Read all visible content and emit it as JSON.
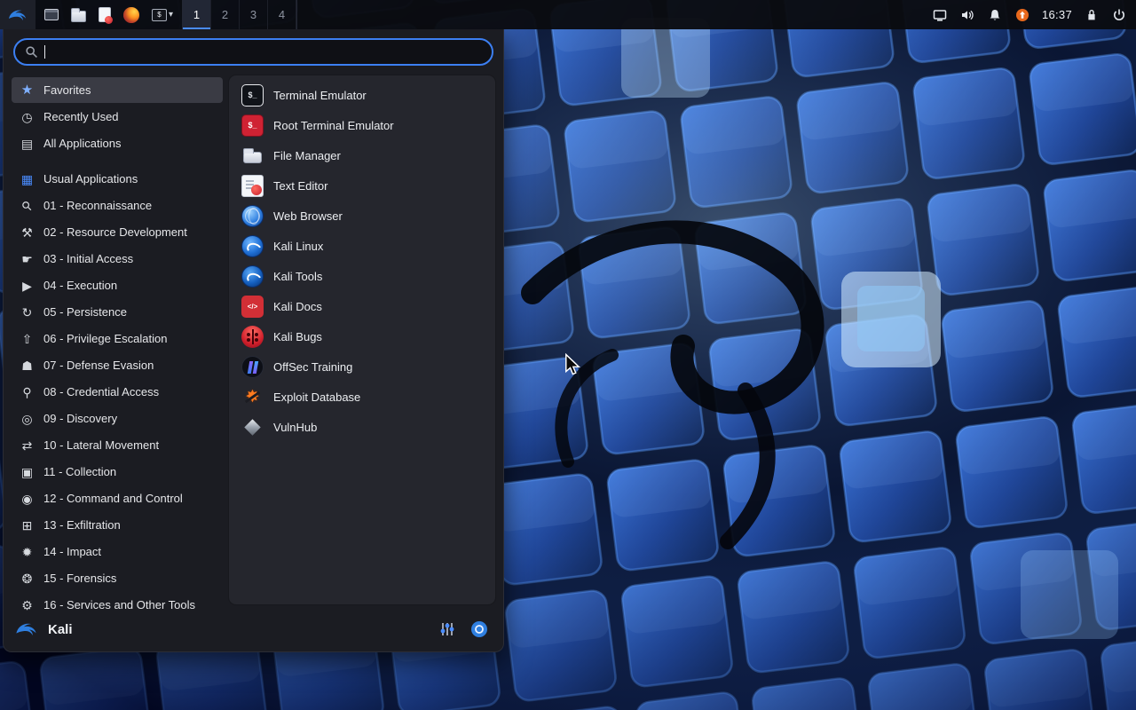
{
  "colors": {
    "accent": "#3c7ff2",
    "kali_blue": "#2f7fe0",
    "panel_bg": "#0a0b10",
    "menu_bg": "#1b1c22",
    "menu_right_bg": "#25262d",
    "selected_row_bg": "#3a3b44",
    "update_orange": "#e8681c",
    "root_terminal_red": "#cf2233"
  },
  "panel": {
    "menu_button": {
      "icon": "kali-menu-icon"
    },
    "taskbar_icons": [
      "window-icon",
      "file-manager-icon",
      "text-editor-icon",
      "firefox-icon",
      "terminal-icon"
    ],
    "terminal_group_caret": "▾",
    "workspaces": [
      "1",
      "2",
      "3",
      "4"
    ],
    "active_workspace": "1",
    "tray_icons": [
      "display-icon",
      "volume-icon",
      "notifications-icon",
      "updates-icon",
      "lock-icon",
      "power-icon"
    ],
    "clock": "16:37"
  },
  "menu": {
    "search": {
      "value": ""
    },
    "selected_category": "Favorites",
    "categories": [
      {
        "label": "Favorites",
        "icon": "star-icon",
        "glyph": "★"
      },
      {
        "label": "Recently Used",
        "icon": "clock-icon",
        "glyph": "◷"
      },
      {
        "label": "All Applications",
        "icon": "list-icon",
        "glyph": "▤"
      },
      {
        "label": "Usual Applications",
        "icon": "grid-icon",
        "glyph": "▦"
      },
      {
        "label": "01 - Reconnaissance",
        "icon": "magnifier-icon",
        "glyph": "⚲"
      },
      {
        "label": "02 - Resource Development",
        "icon": "hammer-icon",
        "glyph": "⚒"
      },
      {
        "label": "03 - Initial Access",
        "icon": "hand-icon",
        "glyph": "☛"
      },
      {
        "label": "04 - Execution",
        "icon": "run-icon",
        "glyph": "▶"
      },
      {
        "label": "05 - Persistence",
        "icon": "refresh-icon",
        "glyph": "↻"
      },
      {
        "label": "06 - Privilege Escalation",
        "icon": "up-arrow-icon",
        "glyph": "⇧"
      },
      {
        "label": "07 - Defense Evasion",
        "icon": "shield-icon",
        "glyph": "☗"
      },
      {
        "label": "08 - Credential Access",
        "icon": "key-icon",
        "glyph": "⚲"
      },
      {
        "label": "09 - Discovery",
        "icon": "radar-icon",
        "glyph": "◎"
      },
      {
        "label": "10 - Lateral Movement",
        "icon": "arrows-icon",
        "glyph": "⇄"
      },
      {
        "label": "11 - Collection",
        "icon": "archive-icon",
        "glyph": "▣"
      },
      {
        "label": "12 - Command and Control",
        "icon": "controller-icon",
        "glyph": "◉"
      },
      {
        "label": "13 - Exfiltration",
        "icon": "export-icon",
        "glyph": "⊞"
      },
      {
        "label": "14 - Impact",
        "icon": "burst-icon",
        "glyph": "✹"
      },
      {
        "label": "15 - Forensics",
        "icon": "fingerprint-icon",
        "glyph": "❂"
      },
      {
        "label": "16 - Services and Other Tools",
        "icon": "toolbox-icon",
        "glyph": "⚙"
      }
    ],
    "apps": [
      {
        "label": "Terminal Emulator",
        "icon": "terminal-icon"
      },
      {
        "label": "Root Terminal Emulator",
        "icon": "root-terminal-icon"
      },
      {
        "label": "File Manager",
        "icon": "file-manager-icon"
      },
      {
        "label": "Text Editor",
        "icon": "text-editor-icon"
      },
      {
        "label": "Web Browser",
        "icon": "web-browser-icon"
      },
      {
        "label": "Kali Linux",
        "icon": "kali-linux-icon"
      },
      {
        "label": "Kali Tools",
        "icon": "kali-tools-icon"
      },
      {
        "label": "Kali Docs",
        "icon": "kali-docs-icon"
      },
      {
        "label": "Kali Bugs",
        "icon": "kali-bugs-icon"
      },
      {
        "label": "OffSec Training",
        "icon": "offsec-icon"
      },
      {
        "label": "Exploit Database",
        "icon": "exploit-db-icon"
      },
      {
        "label": "VulnHub",
        "icon": "vulnhub-icon"
      }
    ],
    "footer": {
      "user": "Kali",
      "icons": [
        "settings-sliders-icon",
        "power-circle-icon"
      ]
    }
  }
}
